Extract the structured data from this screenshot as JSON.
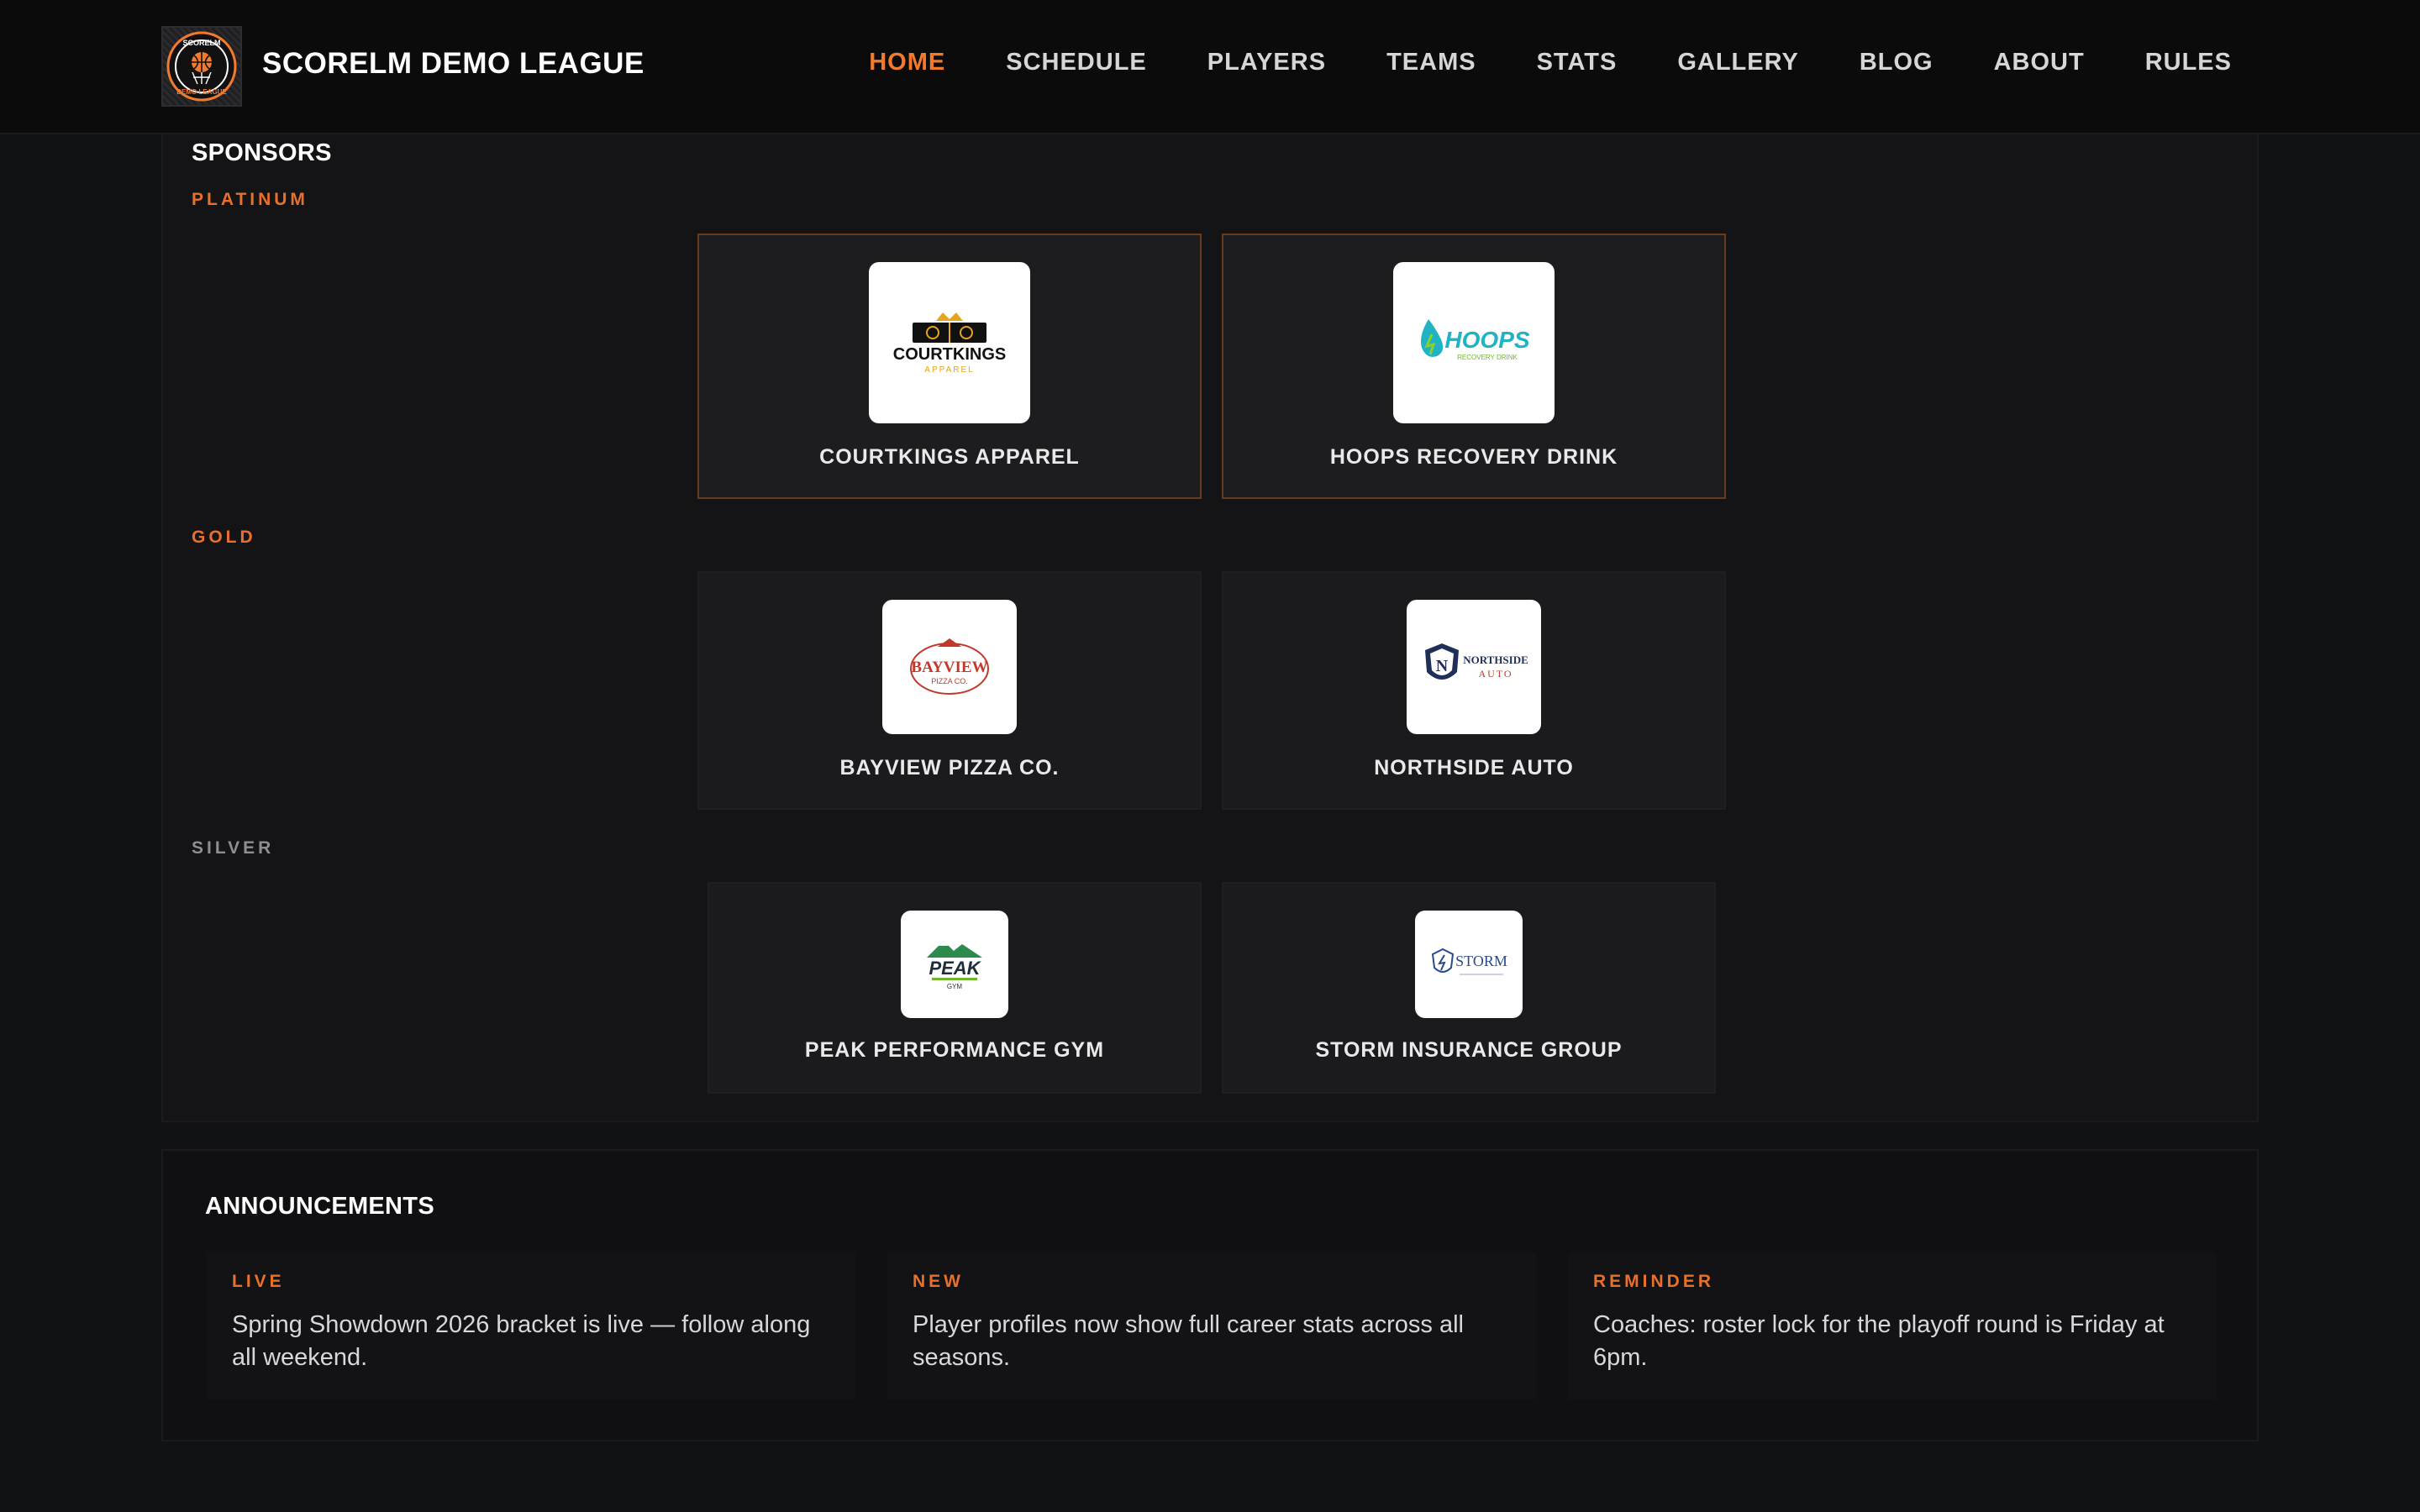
{
  "header": {
    "logo_icon": "basketball-league-logo",
    "brand": "SCORELM DEMO LEAGUE",
    "nav": [
      "HOME",
      "SCHEDULE",
      "PLAYERS",
      "TEAMS",
      "STATS",
      "GALLERY",
      "BLOG",
      "ABOUT",
      "RULES"
    ],
    "active_nav": "HOME"
  },
  "sponsors": {
    "title": "SPONSORS",
    "tiers": {
      "platinum": {
        "label": "PLATINUM",
        "items": [
          {
            "name": "COURTKINGS APPAREL",
            "logo_icon": "courtkings-logo",
            "logo_text": "COURTKINGS",
            "logo_sub": "APPAREL"
          },
          {
            "name": "HOOPS RECOVERY DRINK",
            "logo_icon": "hoops-logo",
            "logo_text": "HOOPS",
            "logo_sub": "RECOVERY DRINK"
          }
        ]
      },
      "gold": {
        "label": "GOLD",
        "items": [
          {
            "name": "BAYVIEW PIZZA CO.",
            "logo_icon": "bayview-pizza-logo",
            "logo_text": "BAYVIEW",
            "logo_sub": "PIZZA CO."
          },
          {
            "name": "NORTHSIDE AUTO",
            "logo_icon": "northside-auto-logo",
            "logo_text": "NORTHSIDE",
            "logo_sub": "AUTO"
          }
        ]
      },
      "silver": {
        "label": "SILVER",
        "items": [
          {
            "name": "PEAK PERFORMANCE GYM",
            "logo_icon": "peak-gym-logo",
            "logo_text": "PEAK",
            "logo_sub": "GYM"
          },
          {
            "name": "STORM INSURANCE GROUP",
            "logo_icon": "storm-insurance-logo",
            "logo_text": "STORM",
            "logo_sub": ""
          }
        ]
      }
    }
  },
  "announcements": {
    "title": "ANNOUNCEMENTS",
    "items": [
      {
        "tag": "LIVE",
        "text": "Spring Showdown 2026 bracket is live — follow along all weekend."
      },
      {
        "tag": "NEW",
        "text": "Player profiles now show full career stats across all seasons."
      },
      {
        "tag": "REMINDER",
        "text": "Coaches: roster lock for the playoff round is Friday at 6pm."
      }
    ]
  },
  "colors": {
    "accent": "#f27a2c",
    "background": "#111214",
    "panel": "#141416"
  }
}
